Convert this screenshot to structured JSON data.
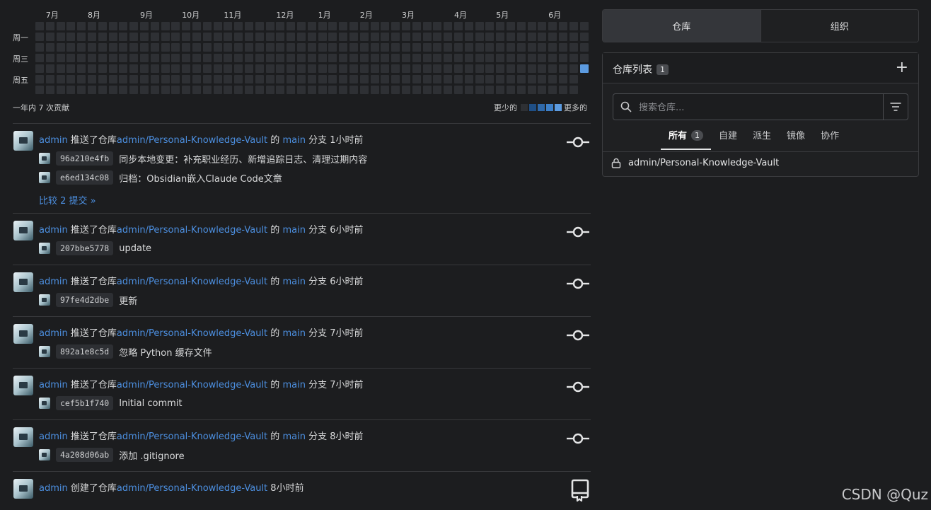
{
  "heatmap": {
    "months": [
      "7月",
      "8月",
      "9月",
      "10月",
      "11月",
      "12月",
      "1月",
      "2月",
      "3月",
      "4月",
      "5月",
      "6月"
    ],
    "month_week_index": [
      1,
      5,
      10,
      14,
      18,
      23,
      27,
      31,
      35,
      40,
      44,
      49
    ],
    "days": [
      "周一",
      "周三",
      "周五"
    ],
    "weeks": 53,
    "active": [
      {
        "week": 52,
        "day": 4,
        "level": 4
      }
    ],
    "footer": "一年内 7 次贡献",
    "legend_less": "更少的",
    "legend_more": "更多的",
    "legend_colors": [
      "#2e3034",
      "#1f4f86",
      "#2f69aa",
      "#3d80c9",
      "#5c9be0"
    ]
  },
  "feed": [
    {
      "user": "admin",
      "action": "推送了仓库",
      "repo": "admin/Personal-Knowledge-Vault",
      "of": "的",
      "branch": "main",
      "branch_word": "分支",
      "time": "1小时前",
      "icon": "commit-icon",
      "commits": [
        {
          "sha": "96a210e4fb",
          "message": "同步本地变更：补充职业经历、新增追踪日志、清理过期内容"
        },
        {
          "sha": "e6ed134c08",
          "message": "归档：Obsidian嵌入Claude Code文章"
        }
      ],
      "compare": "比较 2 提交 »"
    },
    {
      "user": "admin",
      "action": "推送了仓库",
      "repo": "admin/Personal-Knowledge-Vault",
      "of": "的",
      "branch": "main",
      "branch_word": "分支",
      "time": "6小时前",
      "icon": "commit-icon",
      "commits": [
        {
          "sha": "207bbe5778",
          "message": "update"
        }
      ]
    },
    {
      "user": "admin",
      "action": "推送了仓库",
      "repo": "admin/Personal-Knowledge-Vault",
      "of": "的",
      "branch": "main",
      "branch_word": "分支",
      "time": "6小时前",
      "icon": "commit-icon",
      "commits": [
        {
          "sha": "97fe4d2dbe",
          "message": "更新"
        }
      ]
    },
    {
      "user": "admin",
      "action": "推送了仓库",
      "repo": "admin/Personal-Knowledge-Vault",
      "of": "的",
      "branch": "main",
      "branch_word": "分支",
      "time": "7小时前",
      "icon": "commit-icon",
      "commits": [
        {
          "sha": "892a1e8c5d",
          "message": "忽略 Python 缓存文件"
        }
      ]
    },
    {
      "user": "admin",
      "action": "推送了仓库",
      "repo": "admin/Personal-Knowledge-Vault",
      "of": "的",
      "branch": "main",
      "branch_word": "分支",
      "time": "7小时前",
      "icon": "commit-icon",
      "commits": [
        {
          "sha": "cef5b1f740",
          "message": "Initial commit"
        }
      ]
    },
    {
      "user": "admin",
      "action": "推送了仓库",
      "repo": "admin/Personal-Knowledge-Vault",
      "of": "的",
      "branch": "main",
      "branch_word": "分支",
      "time": "8小时前",
      "icon": "commit-icon",
      "commits": [
        {
          "sha": "4a208d06ab",
          "message": "添加 .gitignore"
        }
      ]
    },
    {
      "user": "admin",
      "action": "创建了仓库",
      "repo": "admin/Personal-Knowledge-Vault",
      "time": "8小时前",
      "icon": "repo-icon",
      "commits": []
    }
  ],
  "tabs": {
    "repos": "仓库",
    "orgs": "组织"
  },
  "repo_panel": {
    "title": "仓库列表",
    "count": "1",
    "add_label": "+",
    "search_placeholder": "搜索仓库...",
    "subtabs": [
      {
        "label": "所有",
        "count": "1"
      },
      {
        "label": "自建"
      },
      {
        "label": "派生"
      },
      {
        "label": "镜像"
      },
      {
        "label": "协作"
      }
    ],
    "repos": [
      {
        "name": "admin/Personal-Knowledge-Vault",
        "icon": "lock-icon"
      }
    ]
  },
  "watermark": "CSDN @Quz"
}
